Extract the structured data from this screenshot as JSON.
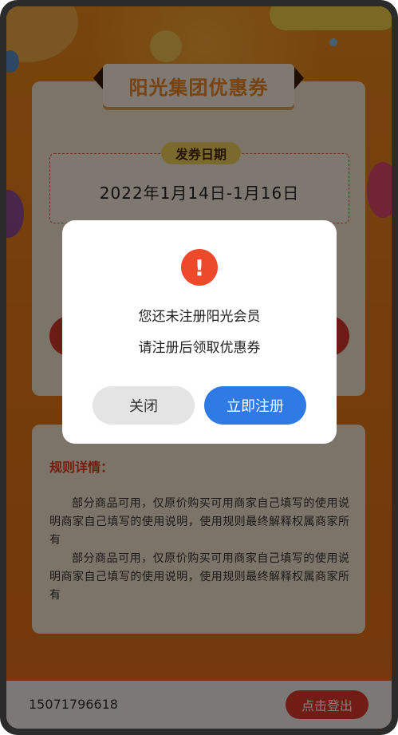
{
  "coupon": {
    "title": "阳光集团优惠券",
    "date_label": "发券日期",
    "date_range": "2022年1月14日-1月16日"
  },
  "rules": {
    "title": "规则详情：",
    "paragraphs": [
      "部分商品可用，仅原价购买可用商家自己填写的使用说明商家自己填写的使用说明，使用规则最终解释权属商家所有",
      "部分商品可用，仅原价购买可用商家自己填写的使用说明商家自己填写的使用说明，使用规则最终解释权属商家所有"
    ]
  },
  "footer": {
    "phone": "15071796618",
    "logout_label": "点击登出"
  },
  "dialog": {
    "icon": "exclamation-icon",
    "icon_glyph": "!",
    "line1": "您还未注册阳光会员",
    "line2": "请注册后领取优惠券",
    "close_label": "关闭",
    "register_label": "立即注册"
  },
  "colors": {
    "background_orange": "#ec7a16",
    "accent_red": "#e23b2b",
    "primary_blue": "#2f7be5",
    "warning_red": "#ec4a2a"
  }
}
